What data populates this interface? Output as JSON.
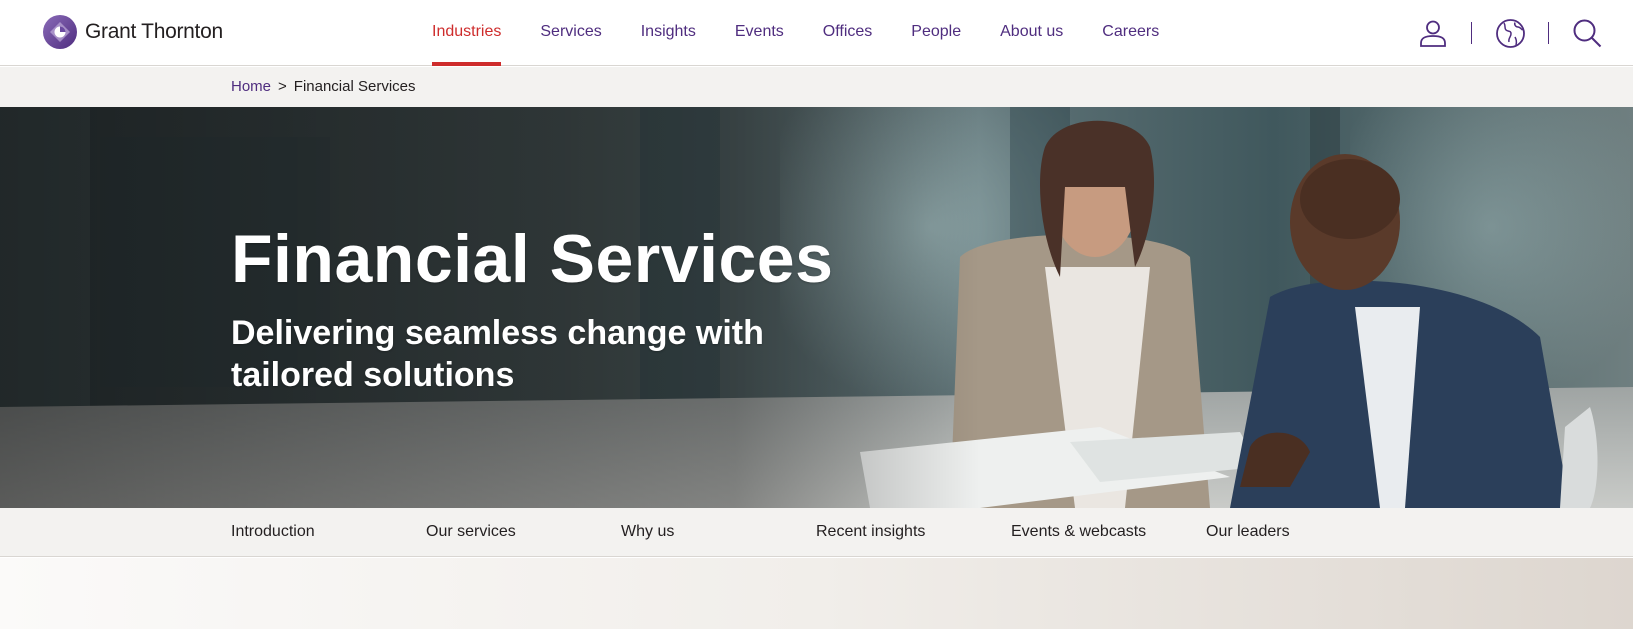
{
  "brand": {
    "name": "Grant Thornton",
    "accent": "#4f2d7f",
    "active": "#ce2c2c"
  },
  "nav": {
    "items": [
      {
        "label": "Industries",
        "active": true
      },
      {
        "label": "Services"
      },
      {
        "label": "Insights"
      },
      {
        "label": "Events"
      },
      {
        "label": "Offices"
      },
      {
        "label": "People"
      },
      {
        "label": "About us"
      },
      {
        "label": "Careers"
      }
    ]
  },
  "tools": {
    "icons": [
      "user-icon",
      "globe-icon",
      "search-icon"
    ]
  },
  "breadcrumb": {
    "home": "Home",
    "separator": ">",
    "current": "Financial Services"
  },
  "hero": {
    "title": "Financial Services",
    "subtitle": "Delivering seamless change with tailored solutions"
  },
  "section_nav": {
    "items": [
      "Introduction",
      "Our services",
      "Why us",
      "Recent insights",
      "Events & webcasts",
      "Our leaders"
    ]
  }
}
